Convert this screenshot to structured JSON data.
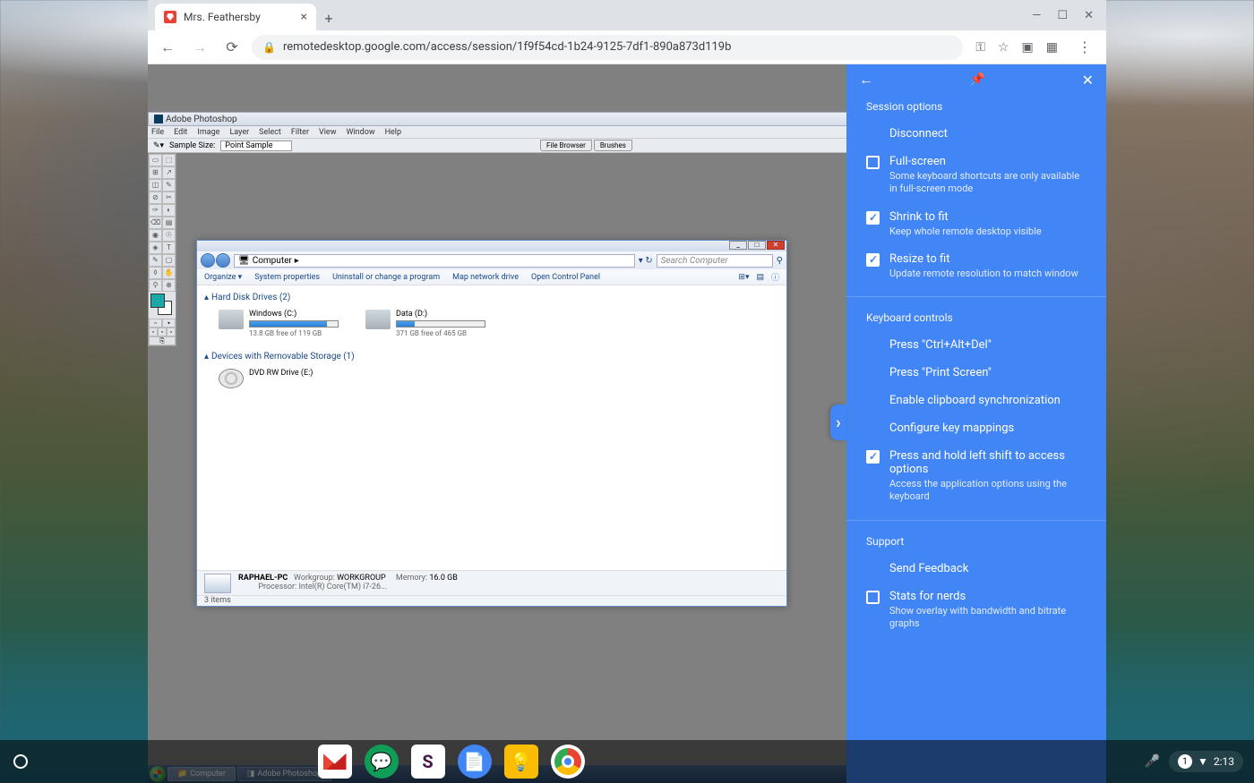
{
  "browser": {
    "tab_title": "Mrs. Feathersby",
    "url": "remotedesktop.google.com/access/session/1f9f54cd-1b24-9125-7df1-890a873d119b"
  },
  "photoshop": {
    "title": "Adobe Photoshop",
    "menu": [
      "File",
      "Edit",
      "Image",
      "Layer",
      "Select",
      "Filter",
      "View",
      "Window",
      "Help"
    ],
    "sample_label": "Sample Size:",
    "sample_value": "Point Sample",
    "tabs": [
      "File Browser",
      "Brushes"
    ]
  },
  "explorer": {
    "path_label": "Computer",
    "search_placeholder": "Search Computer",
    "toolbar": [
      "Organize ▾",
      "System properties",
      "Uninstall or change a program",
      "Map network drive",
      "Open Control Panel"
    ],
    "group_hdd": "Hard Disk Drives (2)",
    "group_removable": "Devices with Removable Storage (1)",
    "drive_c_name": "Windows (C:)",
    "drive_c_free": "13.8 GB free of 119 GB",
    "drive_d_name": "Data (D:)",
    "drive_d_free": "371 GB free of 465 GB",
    "dvd_name": "DVD RW Drive (E:)",
    "pc_name": "RAPHAEL-PC",
    "workgroup_label": "Workgroup:",
    "workgroup": "WORKGROUP",
    "memory_label": "Memory:",
    "memory": "16.0 GB",
    "processor_label": "Processor:",
    "processor": "Intel(R) Core(TM) i7-26...",
    "item_count": "3 items"
  },
  "taskbar": {
    "btn1": "Computer",
    "btn2": "Adobe Photoshop"
  },
  "panel": {
    "section1": "Session options",
    "disconnect": "Disconnect",
    "fullscreen": "Full-screen",
    "fullscreen_sub": "Some keyboard shortcuts are only available in full-screen mode",
    "shrink": "Shrink to fit",
    "shrink_sub": "Keep whole remote desktop visible",
    "resize": "Resize to fit",
    "resize_sub": "Update remote resolution to match window",
    "section2": "Keyboard controls",
    "ctrlaltdel": "Press \"Ctrl+Alt+Del\"",
    "printscreen": "Press \"Print Screen\"",
    "clipboard": "Enable clipboard synchronization",
    "keymap": "Configure key mappings",
    "shift": "Press and hold left shift to access options",
    "shift_sub": "Access the application options using the keyboard",
    "section3": "Support",
    "feedback": "Send Feedback",
    "stats": "Stats for nerds",
    "stats_sub": "Show overlay with bandwidth and bitrate graphs"
  },
  "shelf": {
    "time": "2:13",
    "notif_count": "1"
  }
}
